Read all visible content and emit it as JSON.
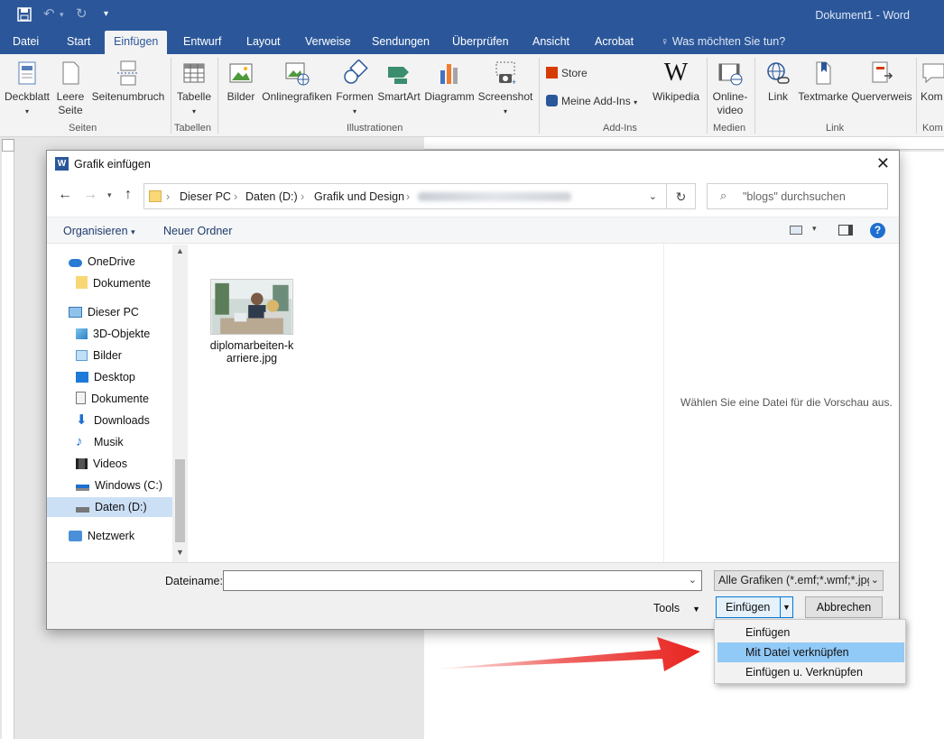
{
  "app": {
    "window_title": "Dokument1 - Word"
  },
  "tabs": [
    "Datei",
    "Start",
    "Einfügen",
    "Entwurf",
    "Layout",
    "Verweise",
    "Sendungen",
    "Überprüfen",
    "Ansicht",
    "Acrobat"
  ],
  "tell_me": "Was möchten Sie tun?",
  "ribbon": {
    "buttons": {
      "deckblatt": "Deckblatt",
      "leere": "Leere",
      "seite": "Seite",
      "seitenumbruch": "Seitenumbruch",
      "tabelle": "Tabelle",
      "bilder": "Bilder",
      "onlinegrafiken": "Onlinegrafiken",
      "formen": "Formen",
      "smartart": "SmartArt",
      "diagramm": "Diagramm",
      "screenshot": "Screenshot",
      "store": "Store",
      "meine_addins": "Meine Add-Ins",
      "wikipedia": "Wikipedia",
      "online": "Online-",
      "video": "video",
      "link": "Link",
      "textmarke": "Textmarke",
      "querverweis": "Querverweis",
      "kom": "Kom"
    },
    "groups": {
      "seiten": "Seiten",
      "tabellen": "Tabellen",
      "illustrationen": "Illustrationen",
      "addins": "Add-Ins",
      "medien": "Medien",
      "link": "Link",
      "kom": "Kom"
    }
  },
  "dialog": {
    "title": "Grafik einfügen",
    "breadcrumb": [
      "Dieser PC",
      "Daten (D:)",
      "Grafik und Design"
    ],
    "search_placeholder": "\"blogs\" durchsuchen",
    "organize": "Organisieren",
    "new_folder": "Neuer Ordner",
    "nav": {
      "onedrive": "OneDrive",
      "dokumente1": "Dokumente",
      "dieser_pc": "Dieser PC",
      "objekte3d": "3D-Objekte",
      "bilder": "Bilder",
      "desktop": "Desktop",
      "dokumente2": "Dokumente",
      "downloads": "Downloads",
      "musik": "Musik",
      "videos": "Videos",
      "windows_c": "Windows (C:)",
      "daten_d": "Daten (D:)",
      "netzwerk": "Netzwerk"
    },
    "file": {
      "name_line1": "diplomarbeiten-k",
      "name_line2": "arriere.jpg"
    },
    "preview_text": "Wählen Sie eine Datei für die Vorschau aus.",
    "filename_label": "Dateiname:",
    "filename_value": "",
    "filter": "Alle Grafiken (*.emf;*.wmf;*.jpg",
    "tools": "Tools",
    "insert": "Einfügen",
    "cancel": "Abbrechen"
  },
  "insert_menu": [
    "Einfügen",
    "Mit Datei verknüpfen",
    "Einfügen u. Verknüpfen"
  ],
  "colors": {
    "word_blue": "#2b579a",
    "menu_highlight": "#91c9f7",
    "arrow_red": "#e8231f",
    "help_blue": "#1e6fd0"
  }
}
